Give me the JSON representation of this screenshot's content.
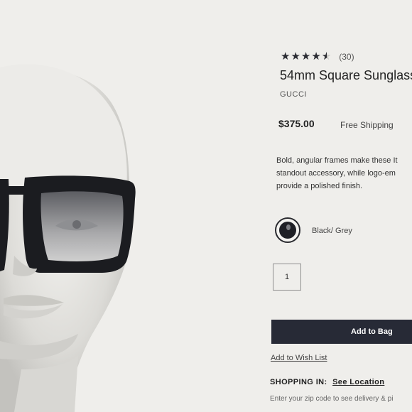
{
  "product": {
    "rating": 4.5,
    "stars": [
      "★",
      "★",
      "★",
      "★",
      "★"
    ],
    "review_count": "(30)",
    "title": "54mm Square Sunglass",
    "brand": "GUCCI",
    "price": "$375.00",
    "shipping": "Free Shipping",
    "description_lines": [
      "Bold, angular frames make these It",
      "standout accessory, while logo-em",
      "provide a polished finish."
    ],
    "color": "Black/ Grey",
    "quantity": "1"
  },
  "actions": {
    "add_to_bag": "Add to Bag",
    "wishlist": "Add to Wish List"
  },
  "shipping_location": {
    "label": "SHOPPING IN:",
    "link": "See Location",
    "hint": "Enter your zip code to see delivery & pi"
  },
  "colors": {
    "background": "#efeeeb",
    "button": "#272a36",
    "frame": "#1b1c20"
  }
}
